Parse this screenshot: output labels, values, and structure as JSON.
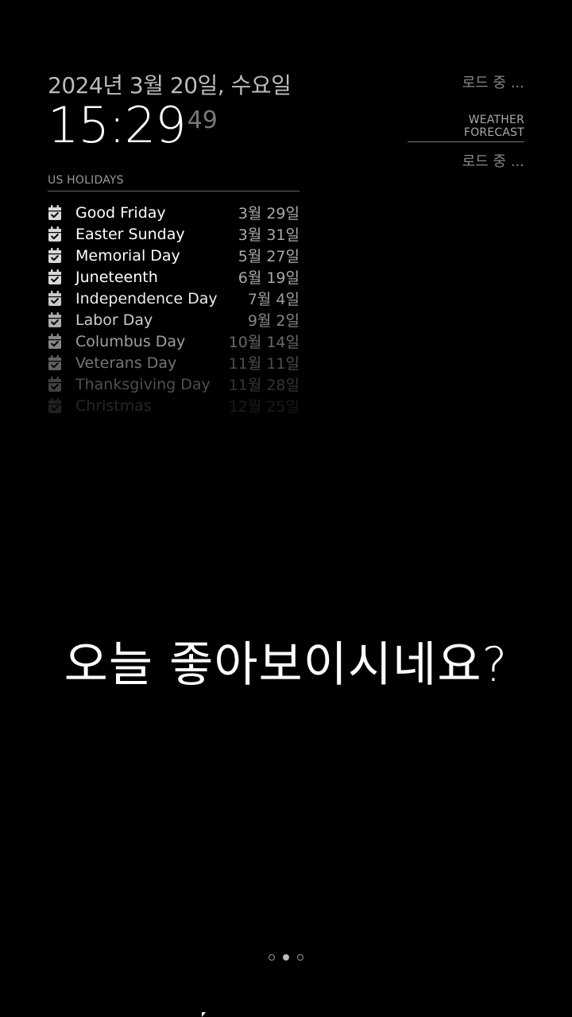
{
  "clock": {
    "date": "2024년 3월 20일, 수요일",
    "time_hm": "15:29",
    "seconds": "49"
  },
  "holidays": {
    "header": "US HOLIDAYS",
    "icon": "calendar-check-icon",
    "items": [
      {
        "name": "Good Friday",
        "date": "3월 29일",
        "opacity": 1.0
      },
      {
        "name": "Easter Sunday",
        "date": "3월 31일",
        "opacity": 1.0
      },
      {
        "name": "Memorial Day",
        "date": "5월 27일",
        "opacity": 1.0
      },
      {
        "name": "Juneteenth",
        "date": "6월 19일",
        "opacity": 1.0
      },
      {
        "name": "Independence Day",
        "date": "7월 4일",
        "opacity": 0.92
      },
      {
        "name": "Labor Day",
        "date": "9월 2일",
        "opacity": 0.8
      },
      {
        "name": "Columbus Day",
        "date": "10월 14일",
        "opacity": 0.62
      },
      {
        "name": "Veterans Day",
        "date": "11월 11일",
        "opacity": 0.45
      },
      {
        "name": "Thanksgiving Day",
        "date": "11월 28일",
        "opacity": 0.3
      },
      {
        "name": "Christmas",
        "date": "12월 25일",
        "opacity": 0.15
      }
    ]
  },
  "weather": {
    "current_loading": "로드 중 ...",
    "forecast_header": "WEATHER FORECAST",
    "forecast_loading": "로드 중 ..."
  },
  "compliment": {
    "text": "오늘 좋아보이시네요?"
  },
  "pages": {
    "count": 3,
    "active_index": 1
  },
  "colors": {
    "background": "#000000",
    "bright": "#ffffff",
    "dimmed": "#999999"
  }
}
